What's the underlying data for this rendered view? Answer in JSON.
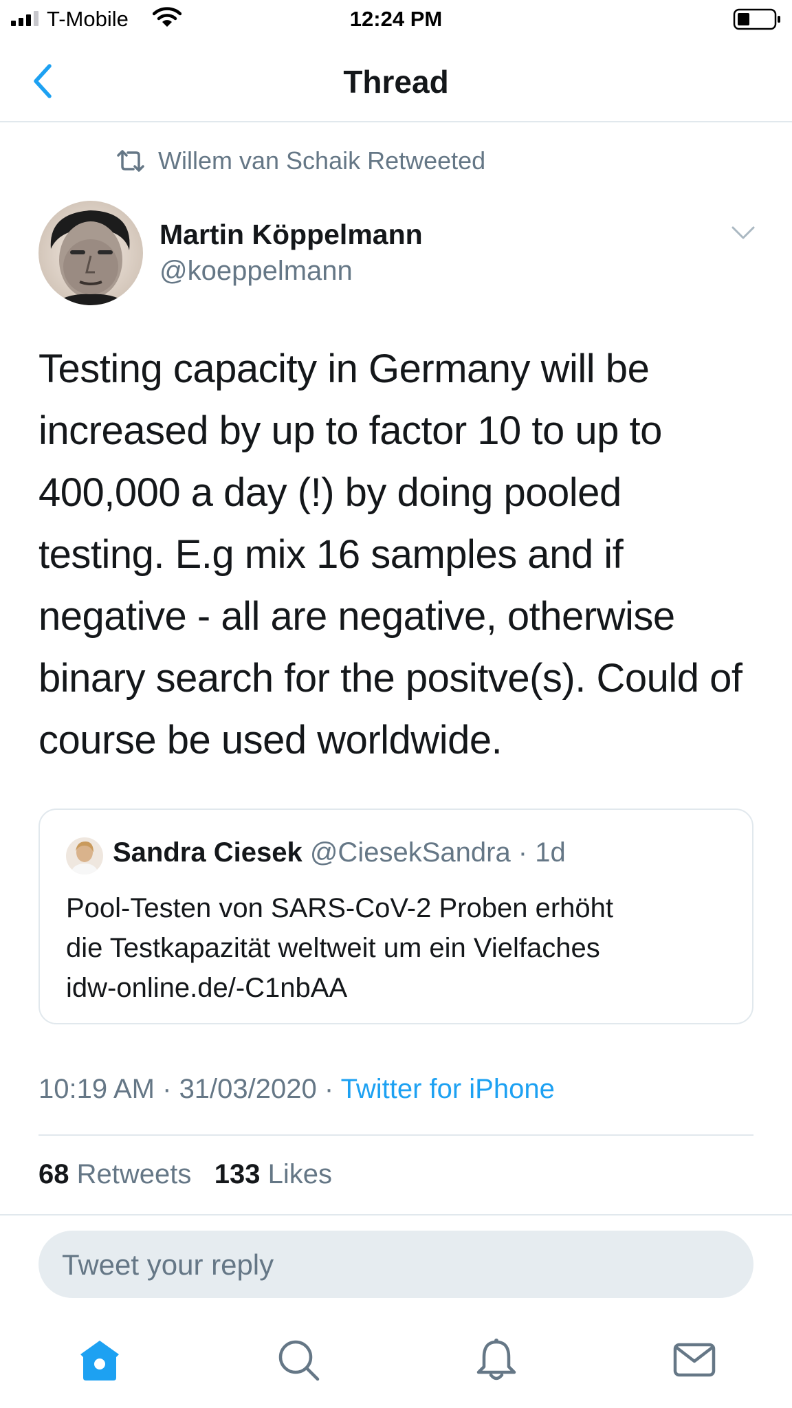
{
  "status_bar": {
    "carrier": "T-Mobile",
    "time": "12:24 PM"
  },
  "nav": {
    "title": "Thread",
    "back_icon": "chevron-left-icon"
  },
  "retweet": {
    "icon": "retweet-icon",
    "text": "Willem van Schaik Retweeted"
  },
  "tweet": {
    "author_name": "Martin Köppelmann",
    "author_handle": "@koeppelmann",
    "text": "Testing capacity in Germany will be increased by up to factor 10 to up to 400,000 a day (!) by doing pooled testing. E.g mix 16 samples and if negative - all are negative, otherwise binary search for the positve(s). Could of course be used worldwide.",
    "time": "10:19 AM",
    "date": "31/03/2020",
    "source": "Twitter for iPhone",
    "retweets_count": "68",
    "retweets_label": "Retweets",
    "likes_count": "133",
    "likes_label": "Likes"
  },
  "quoted": {
    "name": "Sandra Ciesek",
    "handle": "@CiesekSandra",
    "age": "1d",
    "text_line1": "Pool-Testen von SARS-CoV-2 Proben erhöht",
    "text_line2": "die Testkapazität weltweit um ein Vielfaches",
    "text_line3": "idw-online.de/-C1nbAA"
  },
  "reply": {
    "placeholder": "Tweet your reply"
  },
  "tabbar": {
    "items": [
      "home-icon",
      "search-icon",
      "notifications-icon",
      "messages-icon"
    ],
    "active": "home-icon"
  },
  "colors": {
    "accent": "#1da1f2",
    "text": "#14171a",
    "muted": "#657786",
    "border": "#e1e8ed"
  }
}
